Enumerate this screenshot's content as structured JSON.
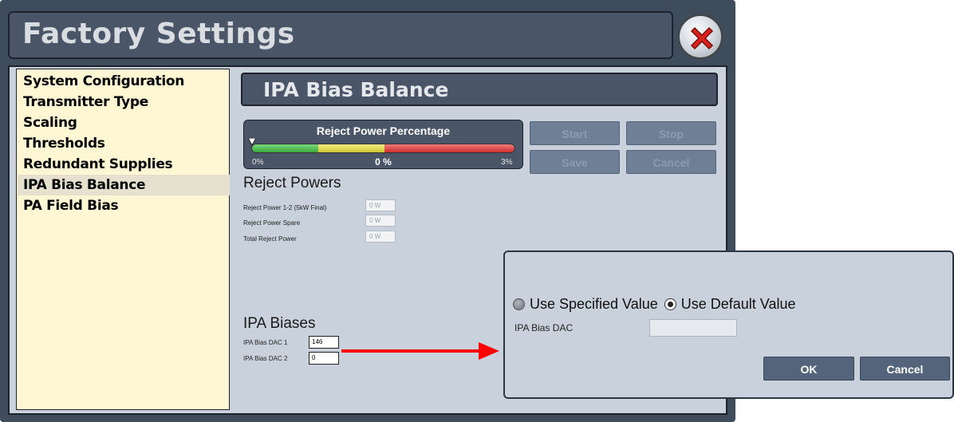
{
  "window": {
    "title": "Factory Settings",
    "close_icon": "close-icon"
  },
  "sidebar": {
    "items": [
      {
        "label": "System Configuration"
      },
      {
        "label": "Transmitter Type"
      },
      {
        "label": "Scaling"
      },
      {
        "label": "Thresholds"
      },
      {
        "label": "Redundant Supplies"
      },
      {
        "label": "IPA Bias Balance",
        "active": true
      },
      {
        "label": "PA Field Bias"
      }
    ]
  },
  "content": {
    "title": "IPA Bias Balance",
    "reject_meter": {
      "title": "Reject Power Percentage",
      "min_label": "0%",
      "value_label": "0 %",
      "max_label": "3%",
      "level_fraction": 0.0,
      "colors": {
        "green": "#3cb33c",
        "yellow": "#e0d93a",
        "red": "#e03a3a"
      }
    },
    "buttons": {
      "start": "Start",
      "stop": "Stop",
      "save": "Save",
      "cancel": "Cancel"
    },
    "reject_powers": {
      "heading": "Reject Powers",
      "rows": [
        {
          "label": "Reject Power 1-2 (5kW Final)",
          "value": "0 W"
        },
        {
          "label": "Reject Power Spare",
          "value": "0 W"
        },
        {
          "label": "Total Reject Power",
          "value": "0 W"
        }
      ]
    },
    "ipa_biases": {
      "heading": "IPA Biases",
      "rows": [
        {
          "label": "IPA Bias DAC 1",
          "value": "146"
        },
        {
          "label": "IPA Bias DAC 2",
          "value": "0"
        }
      ]
    }
  },
  "dialog": {
    "option_specified": "Use Specified Value",
    "option_default": "Use Default Value",
    "selected": "Use Default Value",
    "dac_label": "IPA Bias DAC",
    "dac_value": "",
    "ok": "OK",
    "cancel": "Cancel"
  },
  "colors": {
    "arrow": "#ff0000",
    "header_bg": "#4a5668",
    "panel_bg": "#c8d1dc",
    "sidebar_bg": "#fff6d3"
  }
}
